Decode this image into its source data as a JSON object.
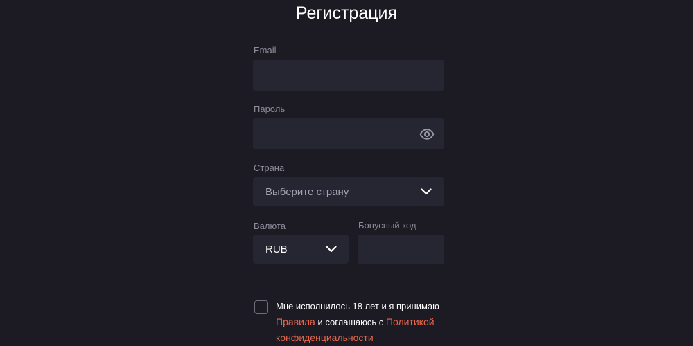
{
  "form": {
    "title": "Регистрация",
    "email": {
      "label": "Email",
      "value": ""
    },
    "password": {
      "label": "Пароль",
      "value": "",
      "icon": "eye-icon"
    },
    "country": {
      "label": "Страна",
      "placeholder": "Выберите страну",
      "icon": "chevron-down-icon"
    },
    "currency": {
      "label": "Валюта",
      "selected": "RUB",
      "icon": "chevron-down-icon"
    },
    "bonus_code": {
      "label": "Бонусный код",
      "value": ""
    },
    "agreement": {
      "checked": false,
      "text_1": "Мне исполнилось 18 лет и я принимаю",
      "rules_link": "Правила",
      "text_2": " и соглашаюсь с ",
      "privacy_link": "Политикой конфиденциальности"
    }
  },
  "colors": {
    "background": "#1c1b24",
    "field": "#262633",
    "label": "#8e8d99",
    "link": "#e8664b"
  }
}
